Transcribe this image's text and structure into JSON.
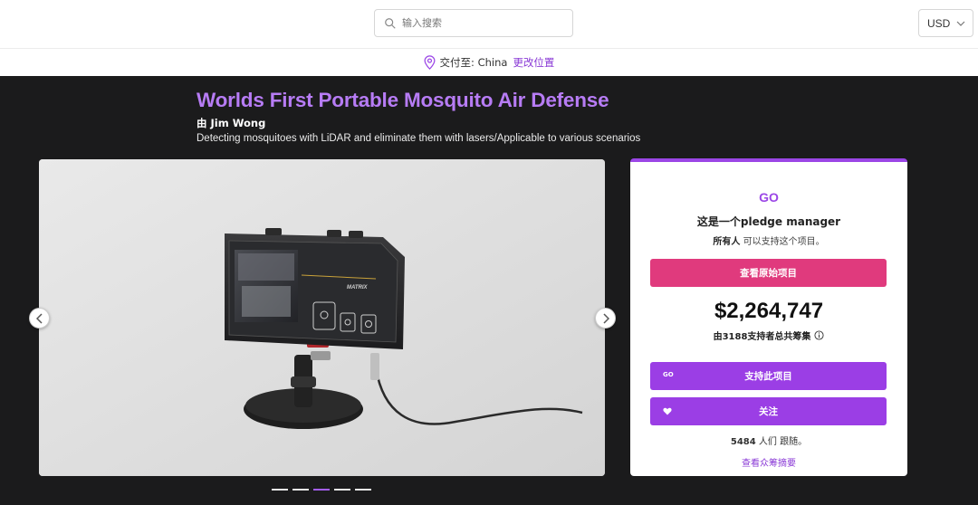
{
  "search": {
    "placeholder": "输入搜索"
  },
  "currency": {
    "value": "USD"
  },
  "shipping": {
    "label": "交付至: China",
    "change_link": "更改位置"
  },
  "project": {
    "title": "Worlds First Portable Mosquito Air Defense",
    "creator": "由 Jim Wong",
    "tagline": "Detecting mosquitoes with LiDAR and eliminate them with lasers/Applicable to various scenarios"
  },
  "gallery": {
    "slide_count": 5,
    "active_index": 2,
    "device_brand": "MATRIX"
  },
  "card": {
    "logo": "GO",
    "heading": "这是一个pledge manager",
    "subtext_owner": "所有人",
    "subtext_rest": "可以支持这个项目。",
    "view_original_button": "查看原始项目",
    "amount": "$2,264,747",
    "backers_text": "由3188支持者总共筹集",
    "support_button": "支持此项目",
    "support_badge": "GO",
    "follow_button": "关注",
    "followers_count": "5484",
    "followers_text": "人们 跟随。",
    "summary_link": "查看众筹摘要"
  },
  "colors": {
    "accent_purple": "#9b3ee5",
    "title_purple": "#b77cf5",
    "pink_button": "#e03a7d",
    "hero_background": "#1b1b1c"
  }
}
